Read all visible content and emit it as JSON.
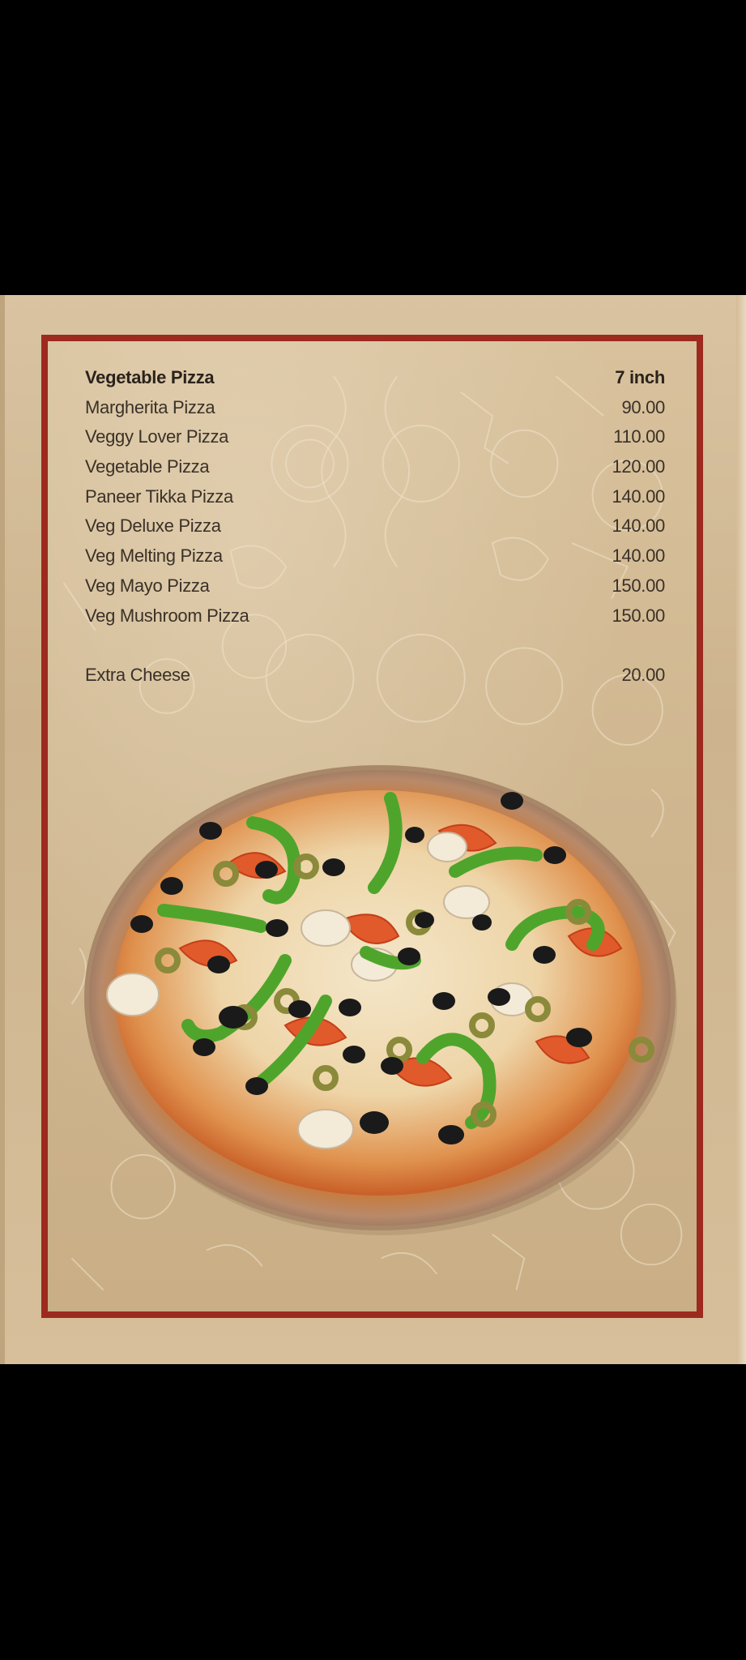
{
  "menu": {
    "header": {
      "title": "Vegetable Pizza",
      "size": "7 inch"
    },
    "items": [
      {
        "name": "Margherita Pizza",
        "price": "90.00"
      },
      {
        "name": "Veggy Lover Pizza",
        "price": "110.00"
      },
      {
        "name": "Vegetable Pizza",
        "price": "120.00"
      },
      {
        "name": "Paneer Tikka Pizza",
        "price": "140.00"
      },
      {
        "name": "Veg Deluxe Pizza",
        "price": "140.00"
      },
      {
        "name": "Veg Melting Pizza",
        "price": "140.00"
      },
      {
        "name": "Veg Mayo Pizza",
        "price": "150.00"
      },
      {
        "name": "Veg Mushroom Pizza",
        "price": "150.00"
      }
    ],
    "extra": {
      "name": "Extra Cheese",
      "price": "20.00"
    }
  },
  "colors": {
    "frame_border": "#9c2a1e",
    "background": "#d8c19c",
    "text": "#3a3128"
  },
  "image": {
    "pizza": "pizza-photo"
  }
}
